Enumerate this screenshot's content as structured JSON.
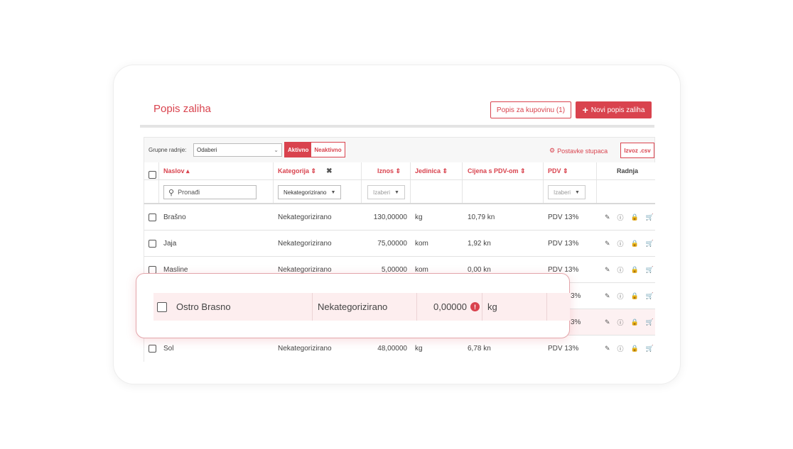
{
  "page": {
    "title": "Popis zaliha"
  },
  "header_buttons": {
    "shopping_list": "Popis za kupovinu (1)",
    "new_list": "Novi popis zaliha"
  },
  "toolbar": {
    "bulk_label": "Grupne radnje:",
    "bulk_select": "Odaberi",
    "toggle_active": "Aktivno",
    "toggle_inactive": "Neaktivno",
    "column_settings": "Postavke stupaca",
    "export": "Izvoz .csv"
  },
  "columns": {
    "title": "Naslov",
    "category": "Kategorija",
    "amount": "Iznos",
    "unit": "Jedinica",
    "price": "Cijena s PDV-om",
    "vat": "PDV",
    "action": "Radnja"
  },
  "filters": {
    "search_placeholder": "Pronađi",
    "category": "Nekategorizirano",
    "amount": "Izaberi",
    "vat": "Izaberi"
  },
  "rows": [
    {
      "title": "Brašno",
      "category": "Nekategorizirano",
      "amount": "130,00000",
      "unit": "kg",
      "price": "10,79 kn",
      "vat": "PDV 13%"
    },
    {
      "title": "Jaja",
      "category": "Nekategorizirano",
      "amount": "75,00000",
      "unit": "kom",
      "price": "1,92 kn",
      "vat": "PDV 13%"
    },
    {
      "title": "Masline",
      "category": "Nekategorizirano",
      "amount": "5,00000",
      "unit": "kom",
      "price": "0,00 kn",
      "vat": "PDV 13%"
    },
    {
      "title": "",
      "category": "",
      "amount": "",
      "unit": "",
      "price": "",
      "vat": "3%"
    },
    {
      "title": "",
      "category": "",
      "amount": "",
      "unit": "",
      "price": "",
      "vat": "3%"
    },
    {
      "title": "Sol",
      "category": "Nekategorizirano",
      "amount": "48,00000",
      "unit": "kg",
      "price": "6,78 kn",
      "vat": "PDV 13%"
    }
  ],
  "highlighted_row": {
    "title": "Ostro Brasno",
    "category": "Nekategorizirano",
    "amount": "0,00000",
    "unit": "kg"
  },
  "colors": {
    "accent": "#d9434e",
    "highlight_bg": "#fdeeef"
  }
}
